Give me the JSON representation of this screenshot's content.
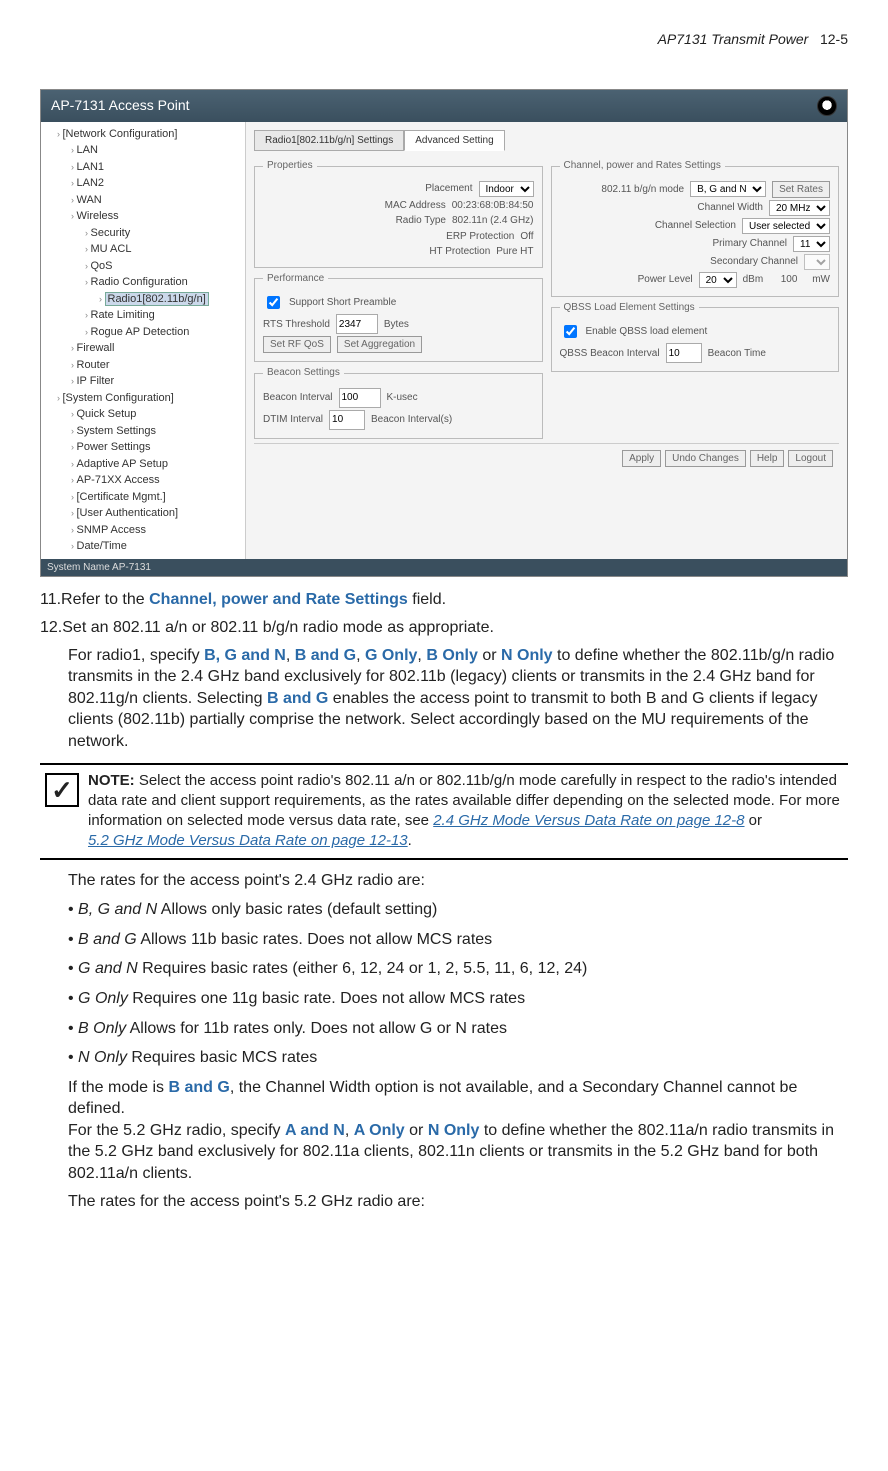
{
  "header": {
    "title": "AP7131 Transmit Power",
    "page": "12-5"
  },
  "screenshot": {
    "titlebar": "AP-7131 Access Point",
    "tree": {
      "root1": "[Network Configuration]",
      "items1": [
        "LAN",
        "LAN1",
        "LAN2",
        "WAN",
        "Wireless"
      ],
      "wireless_children": [
        "Security",
        "MU ACL",
        "QoS",
        "Radio Configuration"
      ],
      "selected": "Radio1[802.11b/g/n]",
      "after_sel": [
        "Rate Limiting",
        "Rogue AP Detection"
      ],
      "items2": [
        "Firewall",
        "Router",
        "IP Filter"
      ],
      "root2": "[System Configuration]",
      "sys_items": [
        "Quick Setup",
        "System Settings",
        "Power Settings",
        "Adaptive AP Setup",
        "AP-71XX Access",
        "[Certificate Mgmt.]",
        "[User Authentication]",
        "SNMP Access",
        "Date/Time"
      ]
    },
    "tabs": {
      "t1": "Radio1[802.11b/g/n] Settings",
      "t2": "Advanced Setting"
    },
    "properties": {
      "legend": "Properties",
      "placement_label": "Placement",
      "placement_val": "Indoor",
      "mac_label": "MAC Address",
      "mac_val": "00:23:68:0B:84:50",
      "type_label": "Radio Type",
      "type_val": "802.11n (2.4 GHz)",
      "erp_label": "ERP Protection",
      "erp_val": "Off",
      "ht_label": "HT Protection",
      "ht_val": "Pure HT"
    },
    "performance": {
      "legend": "Performance",
      "preamble": "Support Short Preamble",
      "rts_label": "RTS Threshold",
      "rts_val": "2347",
      "rts_unit": "Bytes",
      "btn1": "Set RF QoS",
      "btn2": "Set Aggregation"
    },
    "beacon": {
      "legend": "Beacon Settings",
      "bi_label": "Beacon Interval",
      "bi_val": "100",
      "bi_unit": "K-usec",
      "dtim_label": "DTIM Interval",
      "dtim_val": "10",
      "dtim_unit": "Beacon Interval(s)"
    },
    "channel": {
      "legend": "Channel, power and Rates Settings",
      "mode_label": "802.11 b/g/n mode",
      "mode_val": "B, G and N",
      "set_rates": "Set Rates",
      "cw_label": "Channel Width",
      "cw_val": "20 MHz",
      "cs_label": "Channel Selection",
      "cs_val": "User selected",
      "pc_label": "Primary Channel",
      "pc_val": "11",
      "sc_label": "Secondary Channel",
      "sc_val": "",
      "pl_label": "Power Level",
      "pl_val": "20",
      "pl_unit": "dBm",
      "pl_mw": "100",
      "pl_mw_unit": "mW"
    },
    "qbss": {
      "legend": "QBSS Load Element Settings",
      "enable": "Enable QBSS load element",
      "qbi_label": "QBSS Beacon Interval",
      "qbi_val": "10",
      "qbi_unit": "Beacon Time"
    },
    "footer": {
      "apply": "Apply",
      "undo": "Undo Changes",
      "help": "Help",
      "logout": "Logout"
    },
    "status": "System Name AP-7131"
  },
  "doc": {
    "step11_pre": "11.Refer to the ",
    "step11_link": "Channel, power and Rate Settings",
    "step11_post": " field.",
    "step12": "12.Set an 802.11 a/n or 802.11 b/g/n radio mode as appropriate.",
    "para1_a": "For radio1, specify ",
    "modes": [
      "B, G and N",
      "B and G",
      "G Only",
      "B Only",
      "N Only"
    ],
    "para1_b": " to define whether the 802.11b/g/n radio transmits in the 2.4 GHz band exclusively for 802.11b (legacy) clients or transmits in the 2.4 GHz band for 802.11g/n clients. Selecting ",
    "para1_bg": "B and G",
    "para1_c": " enables the access point to transmit to both B and G clients if legacy clients (802.11b) partially comprise the network. Select accordingly based on the MU requirements of the network.",
    "note_label": "NOTE:",
    "note_body": "  Select the access point radio's 802.11 a/n or 802.11b/g/n mode carefully in respect to the radio's intended data rate and client support requirements, as the rates available differ depending on the selected mode. For more information on selected mode versus data rate, see ",
    "note_link1": "2.4 GHz Mode Versus Data Rate on page 12-8",
    "note_or": " or ",
    "note_link2": "5.2 GHz Mode Versus Data Rate on page 12-13",
    "rates24_intro": "The rates for the access point's 2.4 GHz radio are:",
    "rates24": [
      {
        "name": "B, G and N",
        "desc": "   Allows only basic rates (default setting)"
      },
      {
        "name": "B and G",
        "desc": "   Allows 11b basic rates. Does not allow MCS rates"
      },
      {
        "name": "G and N",
        "desc": "   Requires basic rates (either 6, 12, 24 or 1, 2, 5.5, 11, 6, 12, 24)"
      },
      {
        "name": "G Only",
        "desc": "   Requires one 11g basic rate. Does not allow MCS rates"
      },
      {
        "name": "B Only",
        "desc": "   Allows for 11b rates only. Does not allow G or N rates"
      },
      {
        "name": "N Only",
        "desc": "   Requires basic MCS rates"
      }
    ],
    "mode_bg_a": "If the mode is ",
    "mode_bg_lbl": "B and G",
    "mode_bg_b": ", the Channel Width option is not available, and a Secondary Channel cannot be defined.",
    "para52_a": "For the 5.2 GHz radio, specify ",
    "modes52": [
      "A and N",
      "A Only",
      "N Only"
    ],
    "para52_b": " to define whether the 802.11a/n radio transmits in the 5.2 GHz band exclusively for 802.11a clients, 802.11n clients or transmits in the 5.2 GHz band for both 802.11a/n clients.",
    "rates52_intro": "The rates for the access point's 5.2 GHz radio are:"
  }
}
